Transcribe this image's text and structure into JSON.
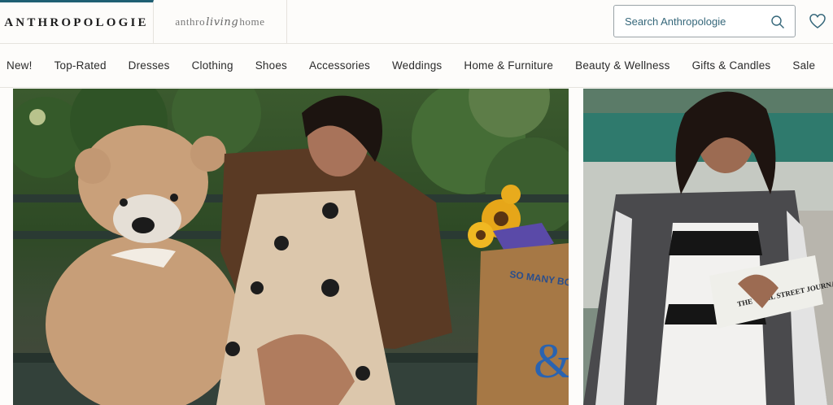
{
  "header": {
    "brand": "ANTHROPOLOGIE",
    "living_tab": {
      "prefix": "anthro",
      "script": "living",
      "suffix": "home"
    },
    "search": {
      "placeholder": "Search Anthropologie"
    }
  },
  "nav": {
    "items": [
      "New!",
      "Top-Rated",
      "Dresses",
      "Clothing",
      "Shoes",
      "Accessories",
      "Weddings",
      "Home & Furniture",
      "Beauty & Wellness",
      "Gifts & Candles",
      "Sale"
    ]
  },
  "hero": {
    "bag_text": "SO MANY BO",
    "newspaper_text": "THE WALL STREET JOURNAL"
  },
  "colors": {
    "accent": "#1f5f73",
    "search_text": "#35677a",
    "heart": "#35677a"
  }
}
